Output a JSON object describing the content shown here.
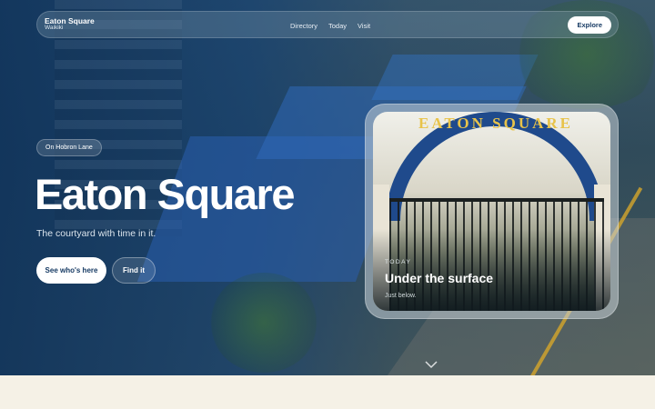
{
  "nav": {
    "brand_title": "Eaton Square",
    "brand_subtitle": "Waikiki",
    "links": [
      "Directory",
      "Today",
      "Visit"
    ],
    "cta_label": "Explore"
  },
  "hero": {
    "eyebrow_pill": "On Hobron Lane",
    "title": "Eaton Square",
    "subtitle": "The courtyard with time in it.",
    "primary_cta": "See who's here",
    "secondary_cta": "Find it"
  },
  "card": {
    "sign_text": "EATON SQUARE",
    "eyebrow": "Today",
    "title": "Under the surface",
    "subtitle": "Just below."
  },
  "colors": {
    "navy": "#163a63",
    "cream": "#f5f1e6",
    "sign_gold": "#e8c34a"
  },
  "icons": {
    "scroll_indicator": "chevron-down-icon"
  }
}
